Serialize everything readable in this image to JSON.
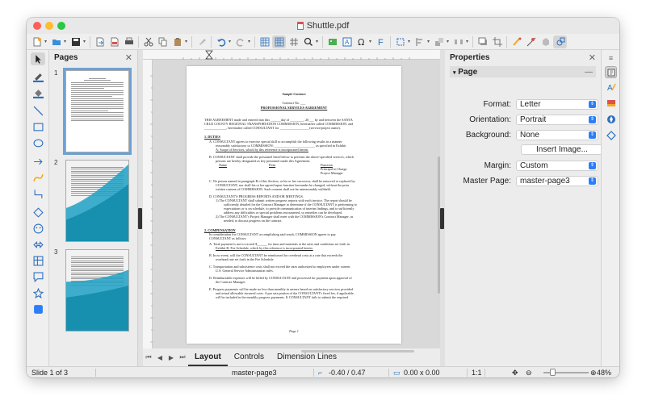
{
  "window": {
    "title": "Shuttle.pdf"
  },
  "pages_panel": {
    "title": "Pages",
    "close": "✕",
    "thumbs": [
      "1",
      "2",
      "3"
    ]
  },
  "document": {
    "lines": {
      "sample": "Sample Contract",
      "contract_no": "Contract No. ___",
      "heading": "PROFESSIONAL SERVICES AGREEMENT",
      "p1": "THIS AGREEMENT made and entered into this ______day of ________, 20___ by and between the SANTA",
      "p1b": "CRUZ COUNTY REGIONAL TRANSPORTATION COMMISSION, hereinafter called COMMISSION, and",
      "p1c": "_____________, hereinafter called CONSULTANT for _________________ (service/project name).",
      "s1": "1.   DUTIES",
      "s1a": "A.  CONSULTANT agrees to exercise special skill to accomplish the following results in a manner",
      "s1a2": "reasonably satisfactory to COMMISSION: ________________________ as specified in Exhibit",
      "s1a3": "A: Scope of Services, which by this reference is incorporated herein.",
      "s1b": "B.  CONSULTANT shall provide the personnel listed below to perform the above-specified services, which",
      "s1b2": "persons are hereby designated as key personnel under this Agreement.",
      "name": "Name",
      "firm": "Firm",
      "function": "Function",
      "pic": "Principal in Charge",
      "pm": "Project Manager",
      "s1c": "C.  No person named in paragraph B of this Section, or his or her successor, shall be removed or replaced by",
      "s1c2": "CONSULTANT, nor shall his or her agreed-upon function hereunder be changed, without the prior",
      "s1c3": "written consent of COMMISSION.  Such consent shall not be unreasonably withheld.",
      "s1d": "D.  CONSULTANT'S PROGRESS REPORTS AND/OR MEETINGS.",
      "s1d1": "1)   The CONSULTANT shall submit written progress reports with each invoice. The report should be",
      "s1d1b": "sufficiently detailed for the Contract Manager to determine if the CONSULTANT is performing to",
      "s1d1c": "expectations or is on schedule, to provide communication of interim findings, and to sufficiently",
      "s1d1d": "address any difficulties or special problems encountered, so remedies can be developed.",
      "s1d2": "2)   The CONSULTANT's Project Manager shall meet with the COMMISSION's Contract Manager, as",
      "s1d2b": "needed, to discuss progress on the contract.",
      "s2": "2.   COMPENSATION",
      "s2i": "In consideration for CONSULTANT accomplishing said result, COMMISSION agrees to pay",
      "s2i2": "CONSULTANT as follows:",
      "s2a": "A.  Total payment is not to exceed $______ for time and materials at the rates and conditions set forth in",
      "s2a2": "Exhibit B: Fee Schedule, which by this reference is incorporated herein.",
      "s2b": "B.  In no event, will the CONSULTANT be reimbursed for overhead costs at a rate that exceeds the",
      "s2b2": "overhead rate set forth in the Fee Schedule.",
      "s2c": "C.  Transportation and subsistence costs shall not exceed the rates authorized to employees under current",
      "s2c2": "U.S. General Service Administration rules.",
      "s2d": "D.  Reimbursable expenses will be billed by CONSULTANT and processed for payment upon approval of",
      "s2d2": "the Contract Manager.",
      "s2e": "E.  Progress payments will be made no less than monthly in arrears based on satisfactory services provided",
      "s2e2": "and actual allowable incurred costs. A pro rata portion of the CONSULTANT's fixed fee, if applicable,",
      "s2e3": "will be included in the monthly progress payments. If CONSULTANT fails to submit the required",
      "footer": "Page 1"
    }
  },
  "tabs": [
    "Layout",
    "Controls",
    "Dimension Lines"
  ],
  "properties": {
    "title": "Properties",
    "close": "✕",
    "section": "Page",
    "format_label": "Format:",
    "format": "Letter",
    "orientation_label": "Orientation:",
    "orientation": "Portrait",
    "background_label": "Background:",
    "background": "None",
    "insert_image": "Insert Image...",
    "margin_label": "Margin:",
    "margin": "Custom",
    "master_label": "Master Page:",
    "master": "master-page3"
  },
  "status": {
    "slide": "Slide 1 of 3",
    "master": "master-page3",
    "position": "-0.40 / 0.47",
    "size": "0.00 x 0.00",
    "ratio": "1:1",
    "zoom": "48%"
  },
  "colors": {
    "accent": "#2c7ef7",
    "teal": "#1fa1c4"
  }
}
